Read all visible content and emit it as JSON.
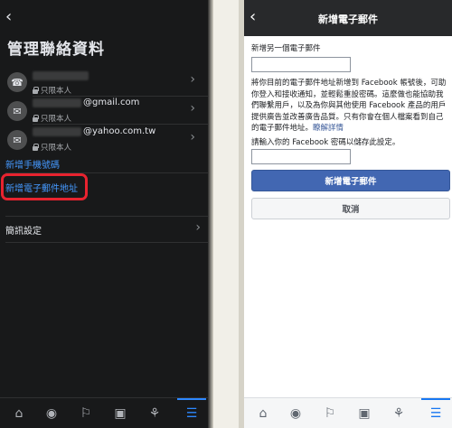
{
  "left": {
    "back_icon": "chevron-left-icon",
    "title": "管理聯絡資料",
    "contacts": [
      {
        "icon": "phone-icon",
        "value": "",
        "privacy": "只限本人"
      },
      {
        "icon": "mail-icon",
        "value": "@gmail.com",
        "privacy": "只限本人"
      },
      {
        "icon": "mail-icon",
        "value": "@yahoo.com.tw",
        "privacy": "只限本人"
      }
    ],
    "add_phone": "新增手機號碼",
    "add_email": "新增電子郵件地址",
    "notification_settings": "簡訊設定"
  },
  "right": {
    "back_icon": "chevron-left-icon",
    "header_title": "新增電子郵件",
    "add_email_label": "新增另一個電子郵件",
    "description": "將你目前的電子郵件地址新增到 Facebook 帳號後，可助你登入和接收通知，並輕鬆重設密碼。這麼做也能協助我們聯繫用戶，以及為你與其他使用 Facebook 產品的用戶提供廣告並改善廣告品質。只有你會在個人檔案看到自己的電子郵件地址。",
    "learn_more": "瞭解詳情",
    "password_label": "請輸入你的 Facebook 密碼以儲存此設定。",
    "submit_button": "新增電子郵件",
    "cancel_button": "取消"
  },
  "tabbar": {
    "items": [
      "home-icon",
      "groups-icon",
      "flag-icon",
      "marketplace-icon",
      "bell-icon",
      "menu-icon"
    ],
    "active": "menu-icon"
  },
  "colors": {
    "highlight": "#e8232f",
    "link_blue": "#4599ff",
    "primary_button": "#4267b2"
  }
}
